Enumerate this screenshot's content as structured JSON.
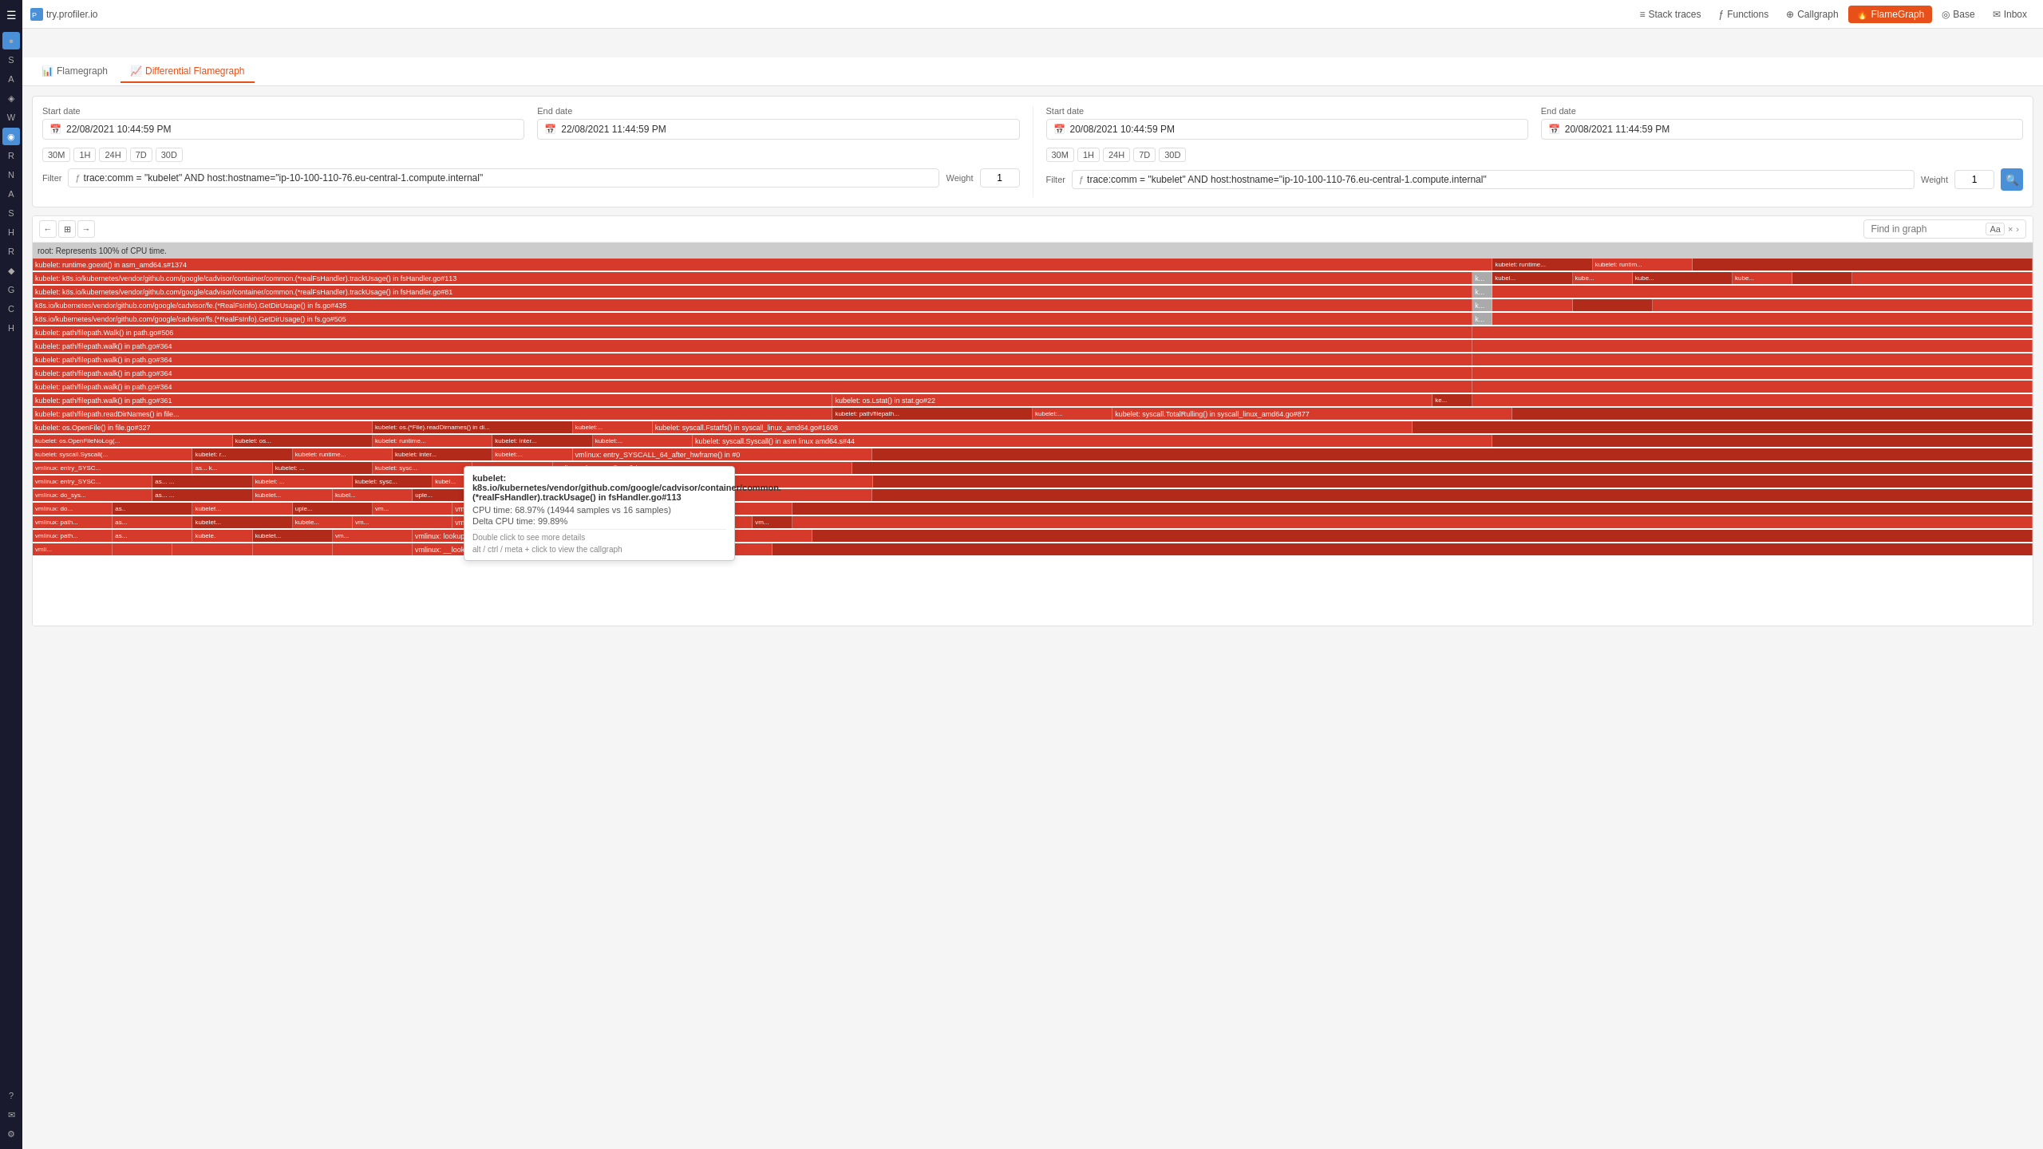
{
  "topbar": {
    "logo_text": "try.profiler.io",
    "nav_items": [
      {
        "label": "Stack traces",
        "icon": "≡",
        "active": false
      },
      {
        "label": "Functions",
        "icon": "ƒ",
        "active": false
      },
      {
        "label": "Callgraph",
        "icon": "⊕",
        "active": false
      },
      {
        "label": "FlameGraph",
        "icon": "🔥",
        "active": true
      },
      {
        "label": "Base",
        "icon": "◎",
        "active": false
      },
      {
        "label": "Inbox",
        "icon": "✉",
        "active": false
      }
    ]
  },
  "tabs": [
    {
      "label": "Flamegraph",
      "icon": "📊",
      "active": false
    },
    {
      "label": "Differential Flamegraph",
      "icon": "📈",
      "active": true
    }
  ],
  "left_panel": {
    "start_date_label": "Start date",
    "end_date_label": "End date",
    "start_date": "22/08/2021 10:44:59 PM",
    "end_date": "22/08/2021 11:44:59 PM",
    "time_ranges": [
      "30M",
      "1H",
      "24H",
      "7D",
      "30D"
    ],
    "filter_label": "Filter",
    "filter_value": "trace:comm = \"kubelet\" AND host:hostname=\"ip-10-100-110-76.eu-central-1.compute.internal\"",
    "weight_label": "Weight",
    "weight_value": "1"
  },
  "right_panel": {
    "start_date_label": "Start date",
    "end_date_label": "End date",
    "start_date": "20/08/2021 10:44:59 PM",
    "end_date": "20/08/2021 11:44:59 PM",
    "time_ranges": [
      "30M",
      "1H",
      "24H",
      "7D",
      "30D"
    ],
    "filter_label": "Filter",
    "filter_value": "trace:comm = \"kubelet\" AND host:hostname=\"ip-10-100-110-76.eu-central-1.compute.internal\"",
    "weight_label": "Weight",
    "weight_value": "1"
  },
  "flamegraph": {
    "find_placeholder": "Find in graph",
    "root_label": "root: Represents 100% of CPU time.",
    "toolbar_nav": [
      "←",
      "⊞",
      "→"
    ]
  },
  "tooltip": {
    "title": "kubelet: k8s.io/kubernetes/vendor/github.com/google/cadvisor/container/common.(*realFsHandler).trackUsage() in fsHandler.go#113",
    "cpu_time": "CPU time: 68.97% (14944 samples vs 16 samples)",
    "delta_cpu": "Delta CPU time: 99.89%",
    "hint1": "Double click to see more details",
    "hint2": "alt / ctrl / meta + click to view the callgraph"
  },
  "sidebar_icons": [
    "☰",
    "●",
    "S",
    "A",
    "◈",
    "W",
    "◉",
    "R",
    "N",
    "A",
    "S",
    "H",
    "R",
    "◆",
    "G",
    "C",
    "H"
  ],
  "bottom_icons": [
    "?",
    "✉"
  ]
}
